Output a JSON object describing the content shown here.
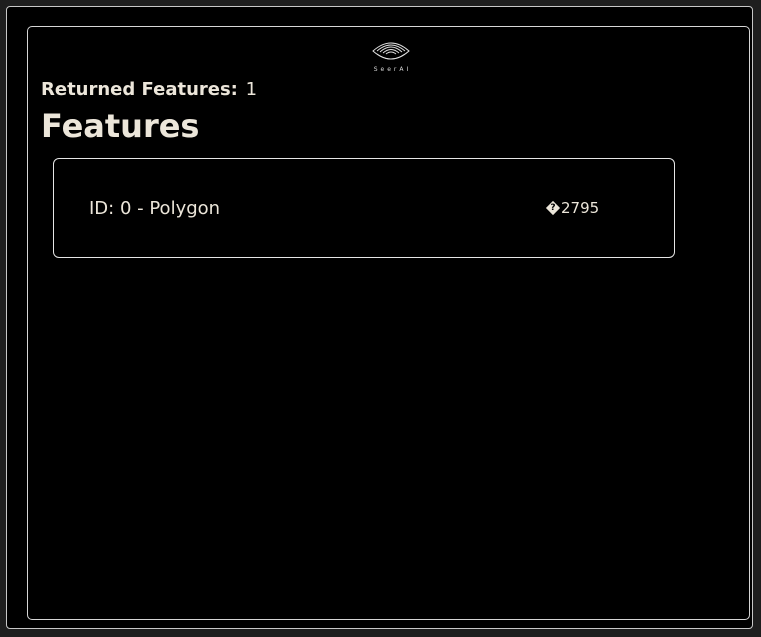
{
  "header": {
    "logo_text": "SeerAI",
    "logo_icon": "eye-logo-icon"
  },
  "summary": {
    "returned_label": "Returned Features:",
    "returned_count": "1"
  },
  "section": {
    "title": "Features"
  },
  "features": [
    {
      "label": "ID: 0 - Polygon",
      "value": "2795",
      "value_icon": "replacement-char-icon",
      "value_icon_glyph": "?"
    }
  ],
  "colors": {
    "background": "#000000",
    "text": "#ece6da",
    "border": "#e6e6e6"
  }
}
